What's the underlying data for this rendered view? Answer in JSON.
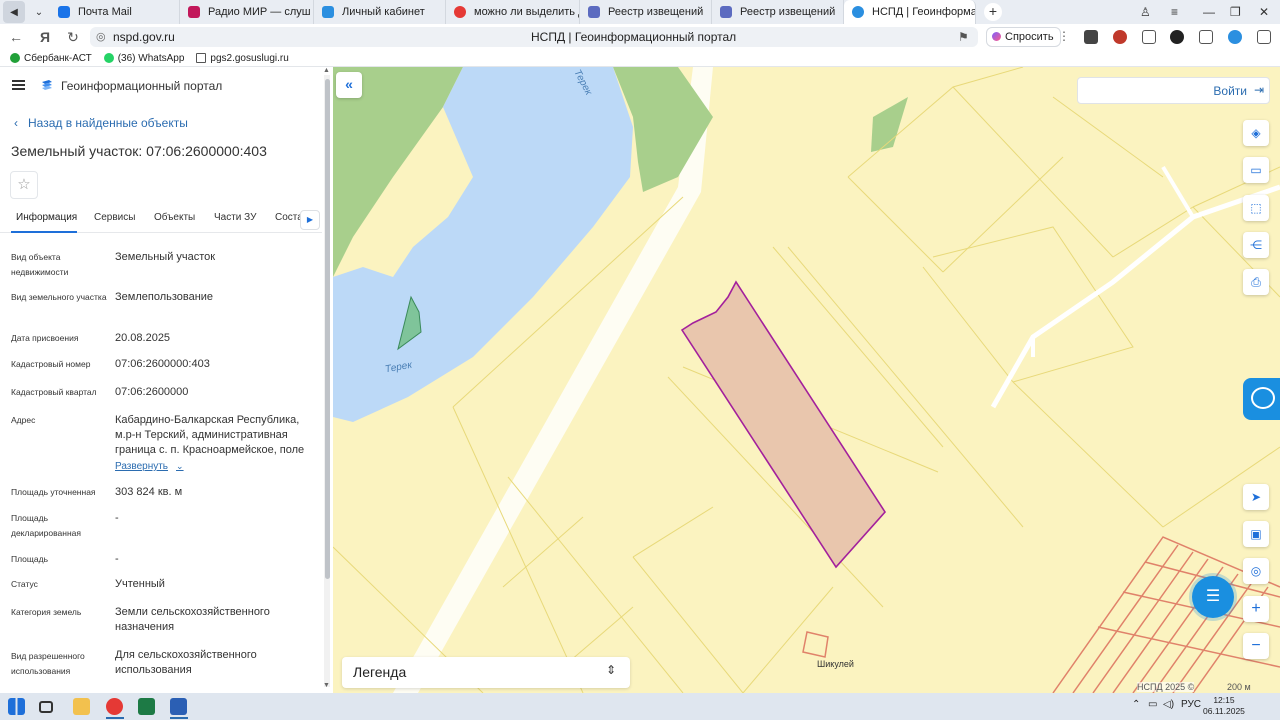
{
  "browser": {
    "tabs": [
      {
        "label": "Почта Mail",
        "color": "#1a73e8"
      },
      {
        "label": "Радио МИР — слуш",
        "color": "#c2185b"
      },
      {
        "label": "Личный кабинет",
        "color": "#2b8fe0"
      },
      {
        "label": "можно ли выделить доля",
        "color": "#e53935"
      },
      {
        "label": "Реестр извещений",
        "color": "#5c6bc0"
      },
      {
        "label": "Реестр извещений",
        "color": "#5c6bc0"
      },
      {
        "label": "НСПД | Геоинформац",
        "color": "#2b8fe0"
      }
    ],
    "url": "nspd.gov.ru",
    "page_title": "НСПД | Геоинформационный портал",
    "ask_label": "Спросить",
    "bookmarks": [
      "Сбербанк-АСТ",
      "(36) WhatsApp",
      "pgs2.gosuslugi.ru"
    ]
  },
  "panel": {
    "portal_title": "Геоинформационный портал",
    "back_label": "Назад в найденные объекты",
    "object_title": "Земельный участок: 07:06:2600000:403",
    "tabs": [
      "Информация",
      "Сервисы",
      "Объекты",
      "Части ЗУ",
      "Соста"
    ],
    "properties": [
      {
        "label": "Вид объекта недвижимости",
        "value": "Земельный участок"
      },
      {
        "label": "Вид земельного участка",
        "value": "Землепользование"
      },
      {
        "label": "Дата присвоения",
        "value": "20.08.2025"
      },
      {
        "label": "Кадастровый номер",
        "value": "07:06:2600000:403"
      },
      {
        "label": "Кадастровый квартал",
        "value": "07:06:2600000"
      },
      {
        "label": "Адрес",
        "value": "Кабардино-Балкарская Республика, м.р-н Терский, административная граница с. п. Красноармейское, поле"
      },
      {
        "label": "Площадь уточненная",
        "value": "303 824 кв. м"
      },
      {
        "label": "Площадь декларированная",
        "value": "-"
      },
      {
        "label": "Площадь",
        "value": "-"
      },
      {
        "label": "Статус",
        "value": "Учтенный"
      },
      {
        "label": "Категория земель",
        "value": "Земли сельскохозяйственного назначения"
      },
      {
        "label": "Вид разрешенного использования",
        "value": "Для сельскохозяйственного использования"
      }
    ],
    "expand_label": "Развернуть"
  },
  "map": {
    "login_label": "Войти",
    "legend_label": "Легенда",
    "river_label_1": "Терек",
    "river_label_2": "Терек",
    "village_label": "Шикулей",
    "copyright": "НСПД 2025 ©",
    "scale_label": "200 м",
    "colors": {
      "field": "#fbf3c0",
      "water": "#bcd9f7",
      "forest": "#a8cf8c",
      "parcel_fill": "#e9c6ad",
      "parcel_stroke": "#a3209c"
    }
  },
  "taskbar": {
    "lang": "РУС",
    "time": "12:15",
    "date": "06.11.2025"
  }
}
